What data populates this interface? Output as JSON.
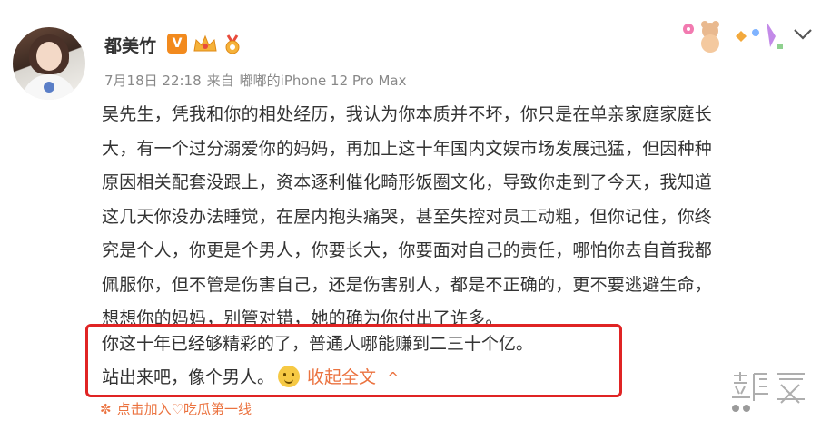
{
  "user": {
    "name": "都美竹",
    "vip_badge": "V"
  },
  "post": {
    "date": "7月18日 22:18",
    "from": "来自",
    "device": "嘟嘟的iPhone 12 Pro Max",
    "lines": [
      "吴先生，凭我和你的相处经历，我认为你本质并不坏，你只是在单亲家庭家庭长",
      "大，有一个过分溺爱你的妈妈，再加上这十年国内文娱市场发展迅猛，但因种种",
      "原因相关配套没跟上，资本逐利催化畸形饭圈文化，导致你走到了今天，我知道",
      "这几天你没办法睡觉，在屋内抱头痛哭，甚至失控对员工动粗，但你记住，你终",
      "究是个人，你更是个男人，你要长大，你要面对自己的责任，哪怕你去自首我都",
      "佩服你，但不管是伤害自己，还是伤害别人，都是不正确的，更不要逃避生命，",
      "想想你的妈妈，别管对错，她的确为你付出了许多。"
    ],
    "highlight_line1": "你这十年已经够精彩的了，普通人哪能赚到二三十个亿。",
    "highlight_line2": "站出来吧，像个男人。",
    "collapse_label": "收起全文",
    "collapse_caret": "^"
  },
  "topic": {
    "symbol": "✼",
    "label": "点击加入♡吃瓜第一线"
  },
  "colors": {
    "accent": "#eb7340",
    "highlight_border": "#e02424",
    "vip": "#f28a1e"
  },
  "icons": {
    "chevron": "chevron-down-icon",
    "crown": "crown-icon",
    "medal": "medal-icon"
  }
}
